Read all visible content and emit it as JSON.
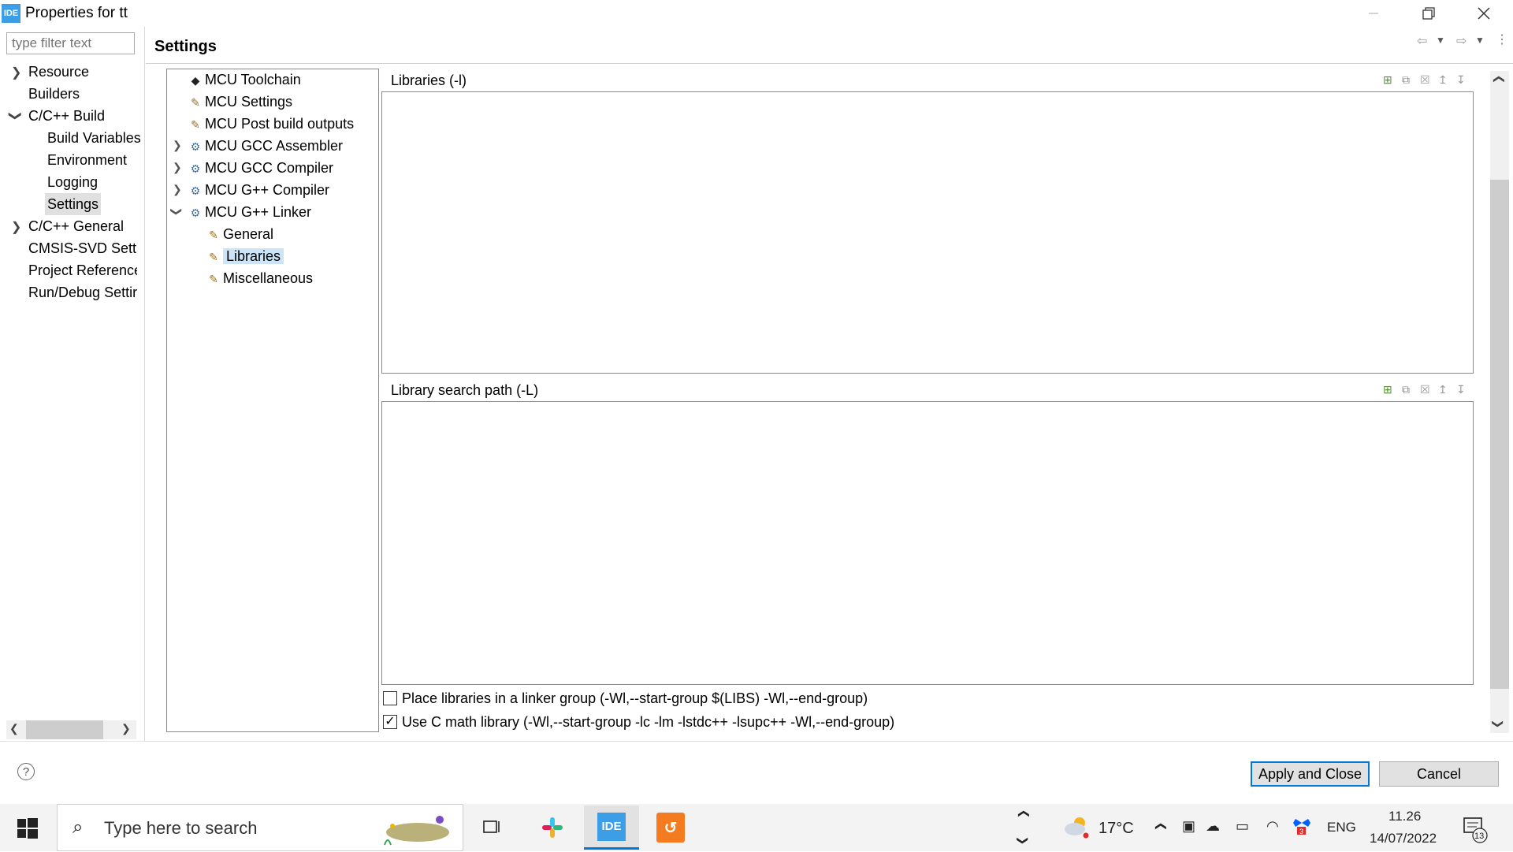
{
  "window": {
    "app_icon_text": "IDE",
    "title": "Properties for tt",
    "minimize_icon": "minimize-icon",
    "restore_icon": "restore-icon",
    "close_icon": "close-icon"
  },
  "left_nav": {
    "filter_placeholder": "type filter text",
    "items": [
      {
        "label": "Resource",
        "expandable": true,
        "expanded": false,
        "level": 0
      },
      {
        "label": "Builders",
        "level": 0
      },
      {
        "label": "C/C++ Build",
        "expandable": true,
        "expanded": true,
        "level": 0
      },
      {
        "label": "Build Variables",
        "level": 1
      },
      {
        "label": "Environment",
        "level": 1
      },
      {
        "label": "Logging",
        "level": 1
      },
      {
        "label": "Settings",
        "level": 1,
        "selected": true
      },
      {
        "label": "C/C++ General",
        "expandable": true,
        "expanded": false,
        "level": 0
      },
      {
        "label": "CMSIS-SVD Settir",
        "level": 0
      },
      {
        "label": "Project References",
        "level": 0
      },
      {
        "label": "Run/Debug Settir",
        "level": 0
      }
    ]
  },
  "settings": {
    "title": "Settings",
    "tool_tree": [
      {
        "label": "MCU Toolchain",
        "icon": "chip-icon"
      },
      {
        "label": "MCU Settings",
        "icon": "option-icon"
      },
      {
        "label": "MCU Post build outputs",
        "icon": "option-icon"
      },
      {
        "label": "MCU GCC Assembler",
        "icon": "tool-gear-icon",
        "expandable": true
      },
      {
        "label": "MCU GCC Compiler",
        "icon": "tool-gear-icon",
        "expandable": true
      },
      {
        "label": "MCU G++ Compiler",
        "icon": "tool-gear-icon",
        "expandable": true
      },
      {
        "label": "MCU G++ Linker",
        "icon": "tool-gear-icon",
        "expandable": true,
        "expanded": true
      },
      {
        "label": "General",
        "icon": "option-icon",
        "child": true
      },
      {
        "label": "Libraries",
        "icon": "option-icon",
        "child": true,
        "selected": true
      },
      {
        "label": "Miscellaneous",
        "icon": "option-icon",
        "child": true
      }
    ],
    "libraries_panel": {
      "label": "Libraries (-l)"
    },
    "search_path_panel": {
      "label": "Library search path (-L)"
    },
    "panel_tool_icons": [
      "add-icon",
      "add-workspace-icon",
      "delete-icon",
      "move-up-icon",
      "move-down-icon"
    ],
    "linker_group_checkbox": {
      "label": "Place libraries in a linker group (-Wl,--start-group $(LIBS) -Wl,--end-group)",
      "checked": false
    },
    "math_lib_checkbox": {
      "label": "Use C math library (-Wl,--start-group -lc -lm -lstdc++ -lsupc++ -Wl,--end-group)",
      "checked": true
    }
  },
  "footer": {
    "help_icon": "help-icon",
    "apply_label": "Apply and Close",
    "cancel_label": "Cancel"
  },
  "taskbar": {
    "search_placeholder": "Type here to search",
    "weather_temp": "17°C",
    "language": "ENG",
    "time": "11.26",
    "date": "14/07/2022",
    "notification_count": "13",
    "pinned_apps": [
      "task-view-icon",
      "slack-icon",
      "ide-icon",
      "pdf-app-icon"
    ],
    "ide_icon_text": "IDE",
    "badge_count": "3"
  }
}
